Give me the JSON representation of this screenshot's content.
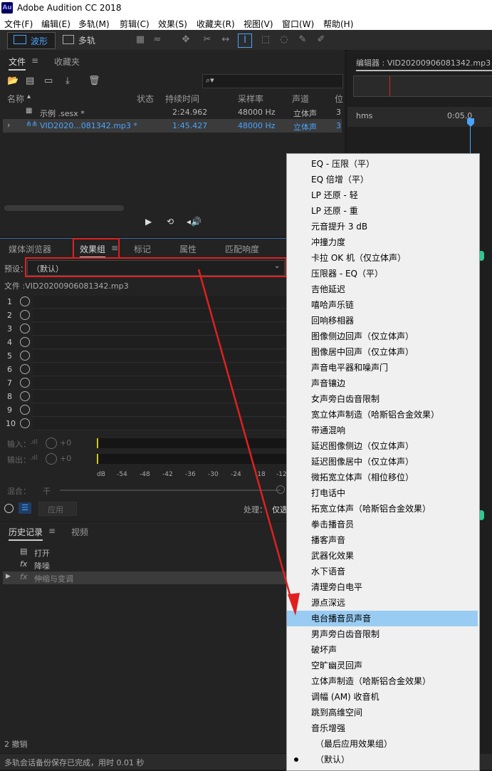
{
  "app": {
    "title": "Adobe Audition CC 2018",
    "logo": "Au"
  },
  "menu": [
    "文件(F)",
    "编辑(E)",
    "多轨(M)",
    "剪辑(C)",
    "效果(S)",
    "收藏夹(R)",
    "视图(V)",
    "窗口(W)",
    "帮助(H)"
  ],
  "toolbar": {
    "waveform_label": "波形",
    "multitrack_label": "多轨"
  },
  "files_panel": {
    "tabs": [
      "文件",
      "收藏夹"
    ],
    "search_placeholder": "",
    "columns": [
      "名称",
      "状态",
      "持续时间",
      "采样率",
      "声道",
      "位"
    ],
    "rows": [
      {
        "name": "示例 .sesx *",
        "status": "",
        "duration": "2:24.962",
        "rate": "48000 Hz",
        "channels": "立体声",
        "bits": "3"
      },
      {
        "name": "VID2020...081342.mp3 *",
        "status": "",
        "duration": "1:45.427",
        "rate": "48000 Hz",
        "channels": "立体声",
        "bits": "3"
      }
    ]
  },
  "editor": {
    "title": "编辑器 : VID20200906081342.mp3 *",
    "ruler_start": "hms",
    "ruler_mark": "0:05.0"
  },
  "effects_panel": {
    "tabs": [
      "媒体浏览器",
      "效果组",
      "标记",
      "属性",
      "匹配响度"
    ],
    "preset_label": "预设：",
    "preset_value": "（默认）",
    "file_label": "文件 :VID20200906081342.mp3",
    "slots": [
      "1",
      "2",
      "3",
      "4",
      "5",
      "6",
      "7",
      "8",
      "9",
      "10"
    ],
    "input_label": "输入：",
    "output_label": "输出：",
    "input_gain": "+0",
    "output_gain": "+0",
    "scale_unit": "dB",
    "scale": [
      "-54",
      "-48",
      "-42",
      "-36",
      "-30",
      "-24",
      "-18",
      "-12"
    ],
    "mix_label": "混合：",
    "mix_dry": "干",
    "apply_label": "应用",
    "process_label": "处理：",
    "process_value": "仅选"
  },
  "history_panel": {
    "tabs": [
      "历史记录",
      "视频"
    ],
    "items": [
      "打开",
      "降噪",
      "伸缩与变调"
    ],
    "undo_count": "2 撤销"
  },
  "status_bar": "多轨会话备份保存已完成，用时 0.01 秒",
  "dropdown": {
    "items": [
      "EQ - 压限（平）",
      "EQ 倍增（平）",
      "LP 还原 - 轻",
      "LP 还原 - 重",
      "元音提升 3 dB",
      "冲撞力度",
      "卡拉 OK 机（仅立体声）",
      "压限器 - EQ（平）",
      "吉他延迟",
      "嘻哈声乐链",
      "回响移相器",
      "图像侧边回声（仅立体声）",
      "图像居中回声（仅立体声）",
      "声音电平器和噪声门",
      "声音镶边",
      "女声旁白齿音限制",
      "宽立体声制造（哈斯铝合金效果）",
      "带通混响",
      "延迟图像侧边（仅立体声）",
      "延迟图像居中（仅立体声）",
      "微拓宽立体声（相位移位）",
      "打电话中",
      "拓宽立体声（哈斯铝合金效果）",
      "拳击播音员",
      "播客声音",
      "武器化效果",
      "水下语音",
      "清理旁白电平",
      "源点深远",
      "电台播音员声音",
      "男声旁白齿音限制",
      "破坏声",
      "空旷幽灵回声",
      "立体声制造（哈斯铝合金效果）",
      "调幅 (AM) 收音机",
      "跳到高维空间",
      "音乐增强",
      "（最后应用效果组）",
      "（默认）"
    ],
    "selected": "电台播音员声音",
    "checked": "（默认）"
  },
  "colors": {
    "accent": "#4aa3ff",
    "annotation": "#e02020",
    "highlight": "#99ccf3"
  }
}
